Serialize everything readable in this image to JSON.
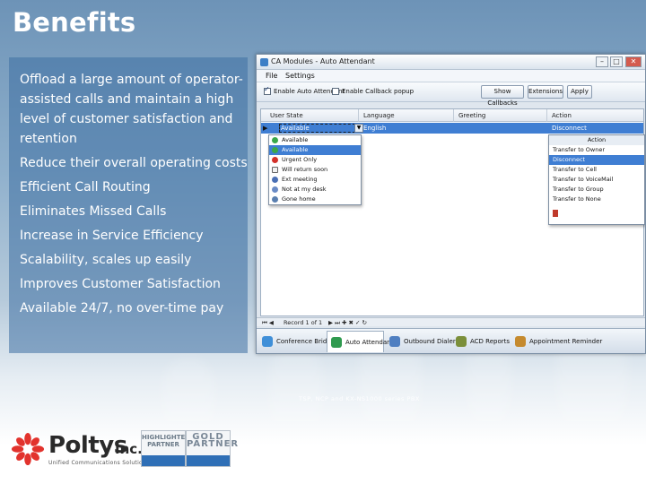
{
  "slide": {
    "title": "Benefits",
    "bullets": [
      "Offload a large amount of operator-assisted calls and maintain a high level of customer satisfaction and retention",
      "Reduce their overall operating costs",
      "Efficient Call Routing",
      "Eliminates Missed Calls",
      "Increase in Service Efficiency",
      "Scalability, scales up easily",
      "Improves Customer Satisfaction",
      "Available 24/7, no over-time pay"
    ],
    "caption": "TSP, NCP and KX-NS1000 series PBX"
  },
  "window": {
    "title": "CA Modules - Auto Attendant",
    "menu": [
      "File",
      "Settings"
    ],
    "toolbar": {
      "enable_auto_attendant": "Enable Auto Attendant",
      "enable_callback": "Enable Callback popup",
      "buttons": [
        "Show Callbacks",
        "Extensions",
        "Apply"
      ]
    },
    "grid": {
      "headers": [
        "User State",
        "Language",
        "Greeting",
        "Action"
      ],
      "selected_row": {
        "state": "Available",
        "language": "English",
        "greeting": "",
        "action": "Disconnect"
      }
    },
    "state_dropdown": [
      "Available",
      "Available",
      "Urgent Only",
      "Will return soon",
      "Ext meeting",
      "Not at my desk",
      "Gone home"
    ],
    "action_dropdown": {
      "header": "Action",
      "items": [
        "Transfer to Owner",
        "Disconnect",
        "Transfer to Cell",
        "Transfer to VoiceMail",
        "Transfer to Group",
        "Transfer to None",
        ""
      ]
    },
    "navigator": "Record 1 of 1",
    "tabs": [
      "Conference Bridge",
      "Auto Attendant",
      "Outbound Dialer",
      "ACD Reports",
      "Appointment Reminder"
    ]
  },
  "logos": {
    "company": "Poltys",
    "suffix": "Inc.",
    "tagline": "Unified Communications Solutions",
    "badge1": "HIGHLIGHTED PARTNER",
    "badge2": "GOLD PARTNER"
  },
  "colors": {
    "accent": "#3f7ed3",
    "panel": "#3e70a2"
  }
}
